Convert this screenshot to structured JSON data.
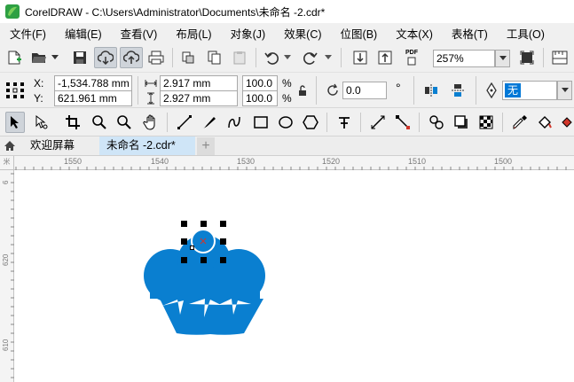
{
  "window": {
    "title": "CorelDRAW - C:\\Users\\Administrator\\Documents\\未命名 -2.cdr*",
    "logo_color": "#2ea043"
  },
  "menubar": {
    "items": [
      {
        "label": "文件(F)"
      },
      {
        "label": "编辑(E)"
      },
      {
        "label": "查看(V)"
      },
      {
        "label": "布局(L)"
      },
      {
        "label": "对象(J)"
      },
      {
        "label": "效果(C)"
      },
      {
        "label": "位图(B)"
      },
      {
        "label": "文本(X)"
      },
      {
        "label": "表格(T)"
      },
      {
        "label": "工具(O)"
      }
    ]
  },
  "toolbar": {
    "zoom_value": "257%",
    "pdf_label": "PDF"
  },
  "property_bar": {
    "x_label": "X:",
    "y_label": "Y:",
    "x_value": "-1,534.788 mm",
    "y_value": "621.961 mm",
    "width_value": "2.917 mm",
    "height_value": "2.927 mm",
    "scale_x": "100.0",
    "scale_y": "100.0",
    "percent": "%",
    "rotation_value": "0.0",
    "degree": "°",
    "outline_value": "无"
  },
  "tabs": {
    "welcome": "欢迎屏幕",
    "document": "未命名 -2.cdr*",
    "add": "+"
  },
  "rulers": {
    "unit_corner": "米",
    "horizontal_ticks": [
      "1550",
      "1540",
      "1530",
      "1520",
      "1510",
      "1500"
    ],
    "vertical_ticks": [
      "6",
      "620",
      "610"
    ]
  },
  "colors": {
    "cupcake_fill": "#0a7fd0",
    "accent": "#0078d7",
    "selection_handle": "#000000"
  }
}
